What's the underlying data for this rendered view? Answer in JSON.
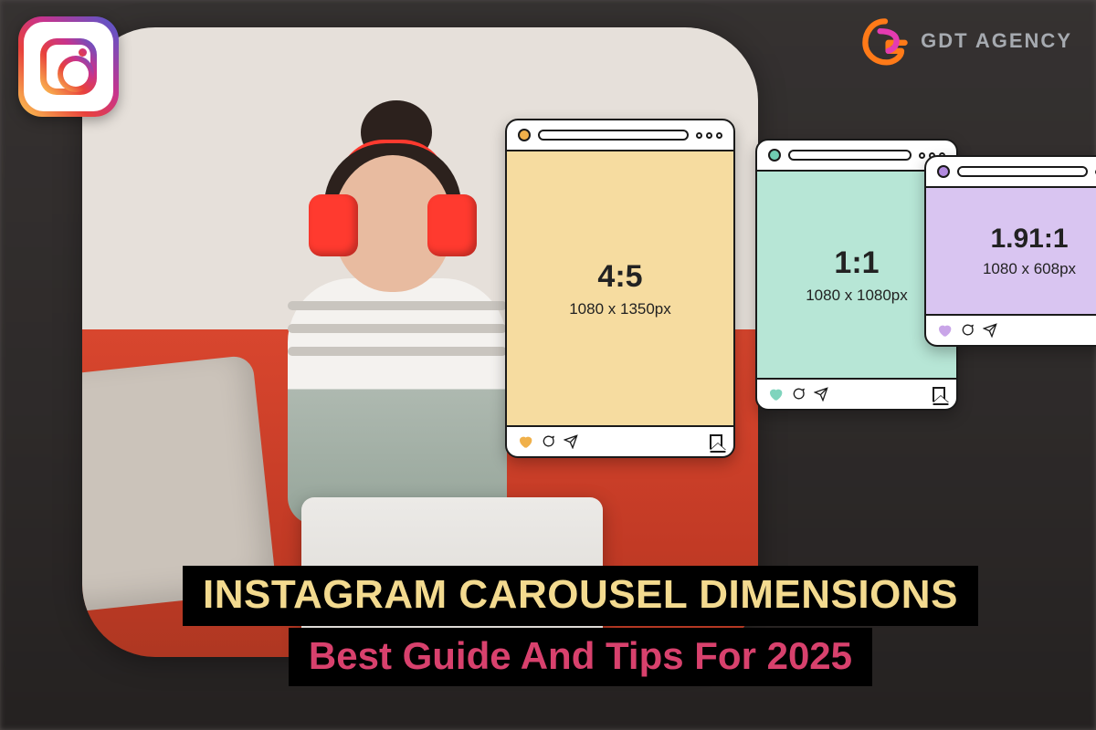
{
  "brand": {
    "name": "GDT AGENCY"
  },
  "badge": {
    "icon": "instagram-icon"
  },
  "headline": {
    "line1": "INSTAGRAM CAROUSEL DIMENSIONS",
    "line2": "Best Guide And Tips For 2025"
  },
  "cards": [
    {
      "ratio": "4:5",
      "dimensions": "1080 x 1350px",
      "fill": "#f6dca0",
      "accent": "#f0b04a"
    },
    {
      "ratio": "1:1",
      "dimensions": "1080 x 1080px",
      "fill": "#b7e6d6",
      "accent": "#6fcdb2"
    },
    {
      "ratio": "1.91:1",
      "dimensions": "1080 x 608px",
      "fill": "#d9c5f1",
      "accent": "#b28adf"
    }
  ],
  "colors": {
    "headline_primary": "#f3da8f",
    "headline_secondary": "#d8416d",
    "headline_bg": "#000000"
  }
}
